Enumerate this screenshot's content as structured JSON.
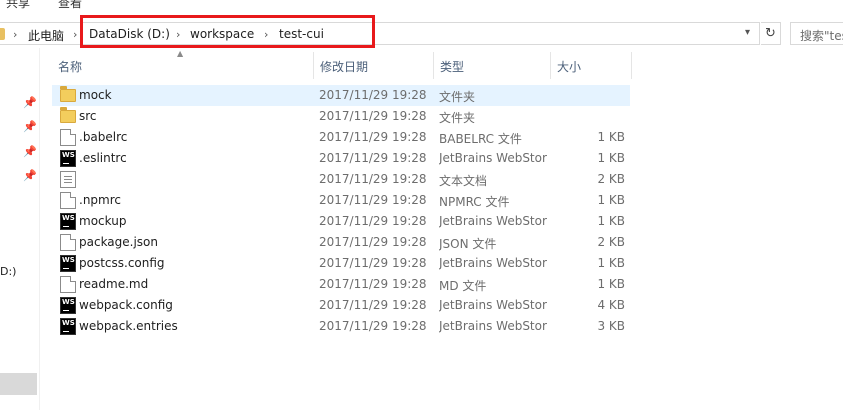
{
  "ribbon": {
    "tabs": [
      "共享",
      "查看"
    ]
  },
  "address": {
    "crumbs": [
      "此电脑",
      "DataDisk (D:)",
      "workspace",
      "test-cui"
    ],
    "refresh_icon": "refresh-icon",
    "dropdown_icon": "chevron-down-icon",
    "search_placeholder": "搜索\"test-cui\""
  },
  "highlight_color": "#e8191b",
  "nav": {
    "drive_label": "D:)"
  },
  "columns": {
    "name": "名称",
    "date": "修改日期",
    "type": "类型",
    "size": "大小"
  },
  "files": [
    {
      "name": "mock",
      "date": "2017/11/29 19:28",
      "type": "文件夹",
      "size": "",
      "icon": "folder",
      "selected": true
    },
    {
      "name": "src",
      "date": "2017/11/29 19:28",
      "type": "文件夹",
      "size": "",
      "icon": "folder"
    },
    {
      "name": ".babelrc",
      "date": "2017/11/29 19:28",
      "type": "BABELRC 文件",
      "size": "1 KB",
      "icon": "doc"
    },
    {
      "name": ".eslintrc",
      "date": "2017/11/29 19:28",
      "type": "JetBrains WebStorm",
      "size": "1 KB",
      "icon": "ws"
    },
    {
      "name": "",
      "date": "2017/11/29 19:28",
      "type": "文本文档",
      "size": "2 KB",
      "icon": "txt"
    },
    {
      "name": ".npmrc",
      "date": "2017/11/29 19:28",
      "type": "NPMRC 文件",
      "size": "1 KB",
      "icon": "doc"
    },
    {
      "name": "mockup",
      "date": "2017/11/29 19:28",
      "type": "JetBrains WebStorm",
      "size": "1 KB",
      "icon": "ws"
    },
    {
      "name": "package.json",
      "date": "2017/11/29 19:28",
      "type": "JSON 文件",
      "size": "2 KB",
      "icon": "doc"
    },
    {
      "name": "postcss.config",
      "date": "2017/11/29 19:28",
      "type": "JetBrains WebStorm",
      "size": "1 KB",
      "icon": "ws"
    },
    {
      "name": "readme.md",
      "date": "2017/11/29 19:28",
      "type": "MD 文件",
      "size": "1 KB",
      "icon": "doc"
    },
    {
      "name": "webpack.config",
      "date": "2017/11/29 19:28",
      "type": "JetBrains WebStorm",
      "size": "4 KB",
      "icon": "ws"
    },
    {
      "name": "webpack.entries",
      "date": "2017/11/29 19:28",
      "type": "JetBrains WebStorm",
      "size": "3 KB",
      "icon": "ws"
    }
  ]
}
